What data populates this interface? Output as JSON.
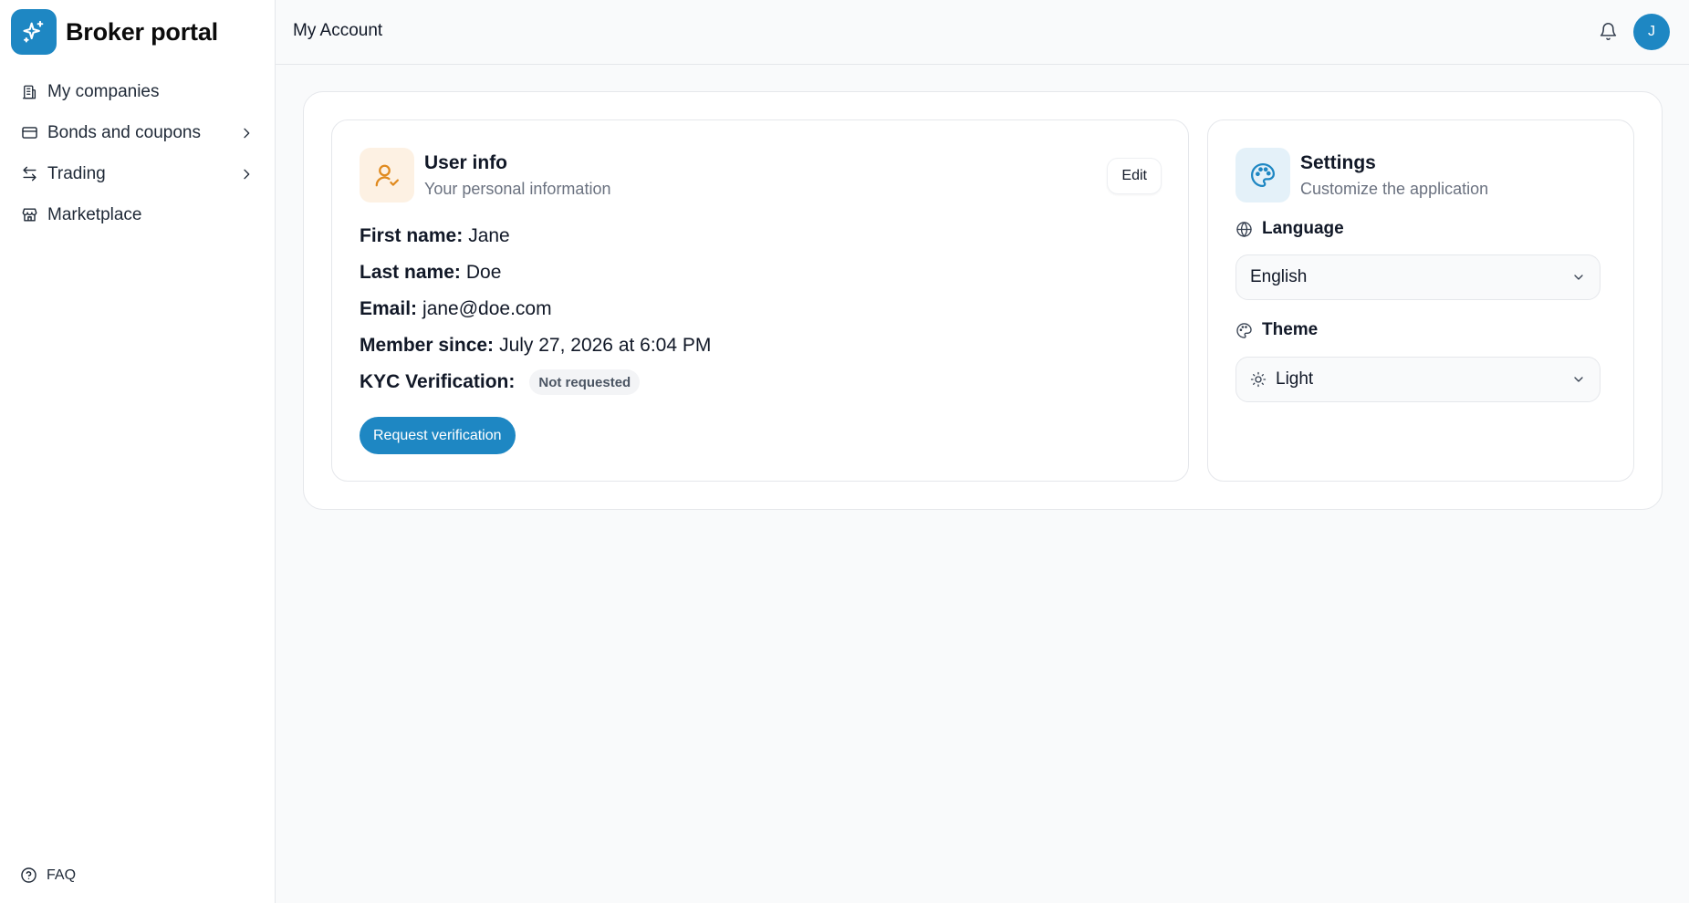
{
  "app": {
    "title": "Broker portal"
  },
  "colors": {
    "accent": "#1e87c3",
    "user_icon_bg": "#fdf1e3",
    "user_icon": "#e08a1e",
    "settings_icon_bg": "#e4f1f9"
  },
  "sidebar": {
    "items": [
      {
        "label": "My companies",
        "icon": "building-icon",
        "has_children": false
      },
      {
        "label": "Bonds and coupons",
        "icon": "credit-card-icon",
        "has_children": true
      },
      {
        "label": "Trading",
        "icon": "arrows-left-right-icon",
        "has_children": true
      },
      {
        "label": "Marketplace",
        "icon": "store-icon",
        "has_children": false
      }
    ],
    "footer": {
      "label": "FAQ",
      "icon": "help-circle-icon"
    }
  },
  "header": {
    "title": "My Account",
    "avatar_initial": "J"
  },
  "user_info": {
    "title": "User info",
    "subtitle": "Your personal information",
    "edit_label": "Edit",
    "fields": {
      "first_name": {
        "label": "First name:",
        "value": "Jane"
      },
      "last_name": {
        "label": "Last name:",
        "value": "Doe"
      },
      "email": {
        "label": "Email:",
        "value": "jane@doe.com"
      },
      "member_since": {
        "label": "Member since:",
        "value": "July 27, 2026 at 6:04 PM"
      },
      "kyc": {
        "label": "KYC Verification:",
        "value": "Not requested"
      }
    },
    "request_label": "Request verification"
  },
  "settings": {
    "title": "Settings",
    "subtitle": "Customize the application",
    "language": {
      "label": "Language",
      "value": "English"
    },
    "theme": {
      "label": "Theme",
      "value": "Light"
    }
  }
}
